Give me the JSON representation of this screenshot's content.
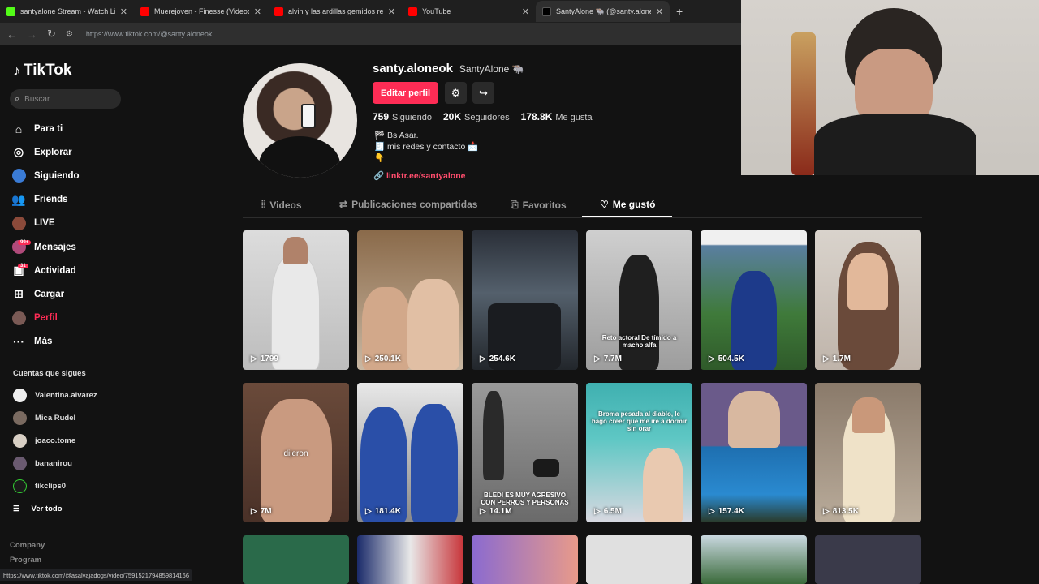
{
  "browser": {
    "tabs": [
      {
        "title": "santyalone Stream - Watch Live",
        "color": "#53fc18"
      },
      {
        "title": "Muerejoven - Finesse (Videoclip",
        "color": "#ff0000"
      },
      {
        "title": "alvin y las ardillas gemidos resu",
        "color": "#ff0000"
      },
      {
        "title": "YouTube",
        "color": "#ff0000"
      },
      {
        "title": "SantyAlone 🐃 (@santy.aloneok",
        "color": "#000000"
      }
    ],
    "url": "https://www.tiktok.com/@santy.aloneok",
    "status_url": "https://www.tiktok.com/@asalvajadogs/video/7591521794859814166"
  },
  "sidebar": {
    "logo": "TikTok",
    "search_placeholder": "Buscar",
    "nav": [
      {
        "label": "Para ti",
        "icon": "home-icon"
      },
      {
        "label": "Explorar",
        "icon": "compass-icon"
      },
      {
        "label": "Siguiendo",
        "icon": "following-icon"
      },
      {
        "label": "Friends",
        "icon": "friends-icon"
      },
      {
        "label": "LIVE",
        "icon": "live-icon"
      },
      {
        "label": "Mensajes",
        "icon": "messages-icon",
        "badge": "99+"
      },
      {
        "label": "Actividad",
        "icon": "activity-icon",
        "badge": "31"
      },
      {
        "label": "Cargar",
        "icon": "upload-icon"
      },
      {
        "label": "Perfil",
        "icon": "profile-icon"
      },
      {
        "label": "Más",
        "icon": "more-icon"
      }
    ],
    "following_title": "Cuentas que sigues",
    "following": [
      "Valentina.alvarez",
      "Mica Rudel",
      "joaco.tome",
      "bananirou",
      "tikclips0"
    ],
    "see_all": "Ver todo",
    "footer": [
      "Company",
      "Program"
    ]
  },
  "profile": {
    "username": "santy.aloneok",
    "display_name": "SantyAlone 🐃",
    "edit_label": "Editar perfil",
    "stats": [
      {
        "value": "759",
        "label": "Siguiendo"
      },
      {
        "value": "20K",
        "label": "Seguidores"
      },
      {
        "value": "178.8K",
        "label": "Me gusta"
      }
    ],
    "bio": [
      "🏁 Bs Asar.",
      "🧾 mis redes y contacto 📩",
      "👇"
    ],
    "link": "linktr.ee/santyalone"
  },
  "tabs": [
    {
      "label": "Videos"
    },
    {
      "label": "Publicaciones compartidas"
    },
    {
      "label": "Favoritos"
    },
    {
      "label": "Me gustó"
    }
  ],
  "videos": [
    {
      "views": "1799"
    },
    {
      "views": "250.1K"
    },
    {
      "views": "254.6K"
    },
    {
      "views": "7.7M",
      "caption": "Reto actoral De tímido a macho alfa"
    },
    {
      "views": "504.5K"
    },
    {
      "views": "1.7M"
    },
    {
      "views": "7M",
      "caption": "dijeron"
    },
    {
      "views": "181.4K"
    },
    {
      "views": "14.1M",
      "caption": "BLEDI ES MUY AGRESIVO CON PERROS Y PERSONAS"
    },
    {
      "views": "6.5M",
      "caption": "Broma pesada al diablo, le hago creer que me iré a dormir sin orar"
    },
    {
      "views": "157.4K"
    },
    {
      "views": "813.5K"
    }
  ]
}
